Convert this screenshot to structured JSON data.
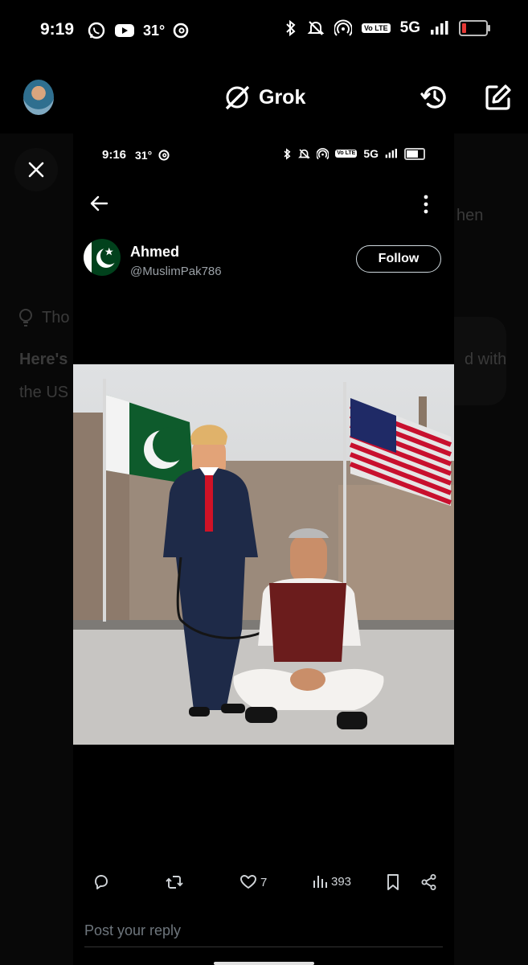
{
  "status_bar": {
    "time": "9:19",
    "temperature": "31°",
    "network": "5G",
    "volte": "Vo LTE",
    "icons": [
      "whatsapp-icon",
      "youtube-icon",
      "threads-icon",
      "bluetooth-icon",
      "mute-icon",
      "hotspot-icon",
      "volte-icon",
      "signal-icon",
      "battery-low-icon"
    ]
  },
  "app_bar": {
    "title": "Grok",
    "icons": [
      "grok-logo-icon",
      "history-icon",
      "compose-icon"
    ]
  },
  "background": {
    "partial_texts": [
      "hen",
      "Tho",
      "Here's",
      "d with",
      "the US"
    ]
  },
  "inner_screenshot": {
    "status_bar": {
      "time": "9:16",
      "temperature": "31°",
      "network": "5G",
      "volte": "Vo LTE"
    },
    "author": {
      "name": "Ahmed",
      "handle": "@MuslimPak786"
    },
    "follow_label": "Follow",
    "actions": {
      "likes": "7",
      "views": "393"
    },
    "reply_placeholder": "Post your reply"
  },
  "colors": {
    "background": "#000000",
    "text": "#e7e9ea",
    "muted": "#9aa0a6",
    "pak_green": "#01411c"
  }
}
